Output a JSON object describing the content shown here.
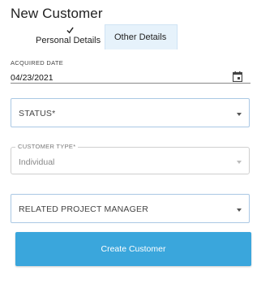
{
  "page": {
    "title": "New Customer"
  },
  "tabs": [
    {
      "label": "Personal Details",
      "completed": true
    },
    {
      "label": "Other Details",
      "active": true
    }
  ],
  "form": {
    "acquired_date": {
      "label": "ACQUIRED DATE",
      "value": "04/23/2021",
      "icon": "calendar-icon"
    },
    "status": {
      "label": "STATUS",
      "required_mark": "*"
    },
    "customer_type": {
      "label": "CUSTOMER TYPE",
      "required_mark": "*",
      "value": "Individual"
    },
    "project_manager": {
      "label": "RELATED PROJECT MANAGER"
    }
  },
  "actions": {
    "submit_label": "Create Customer"
  },
  "colors": {
    "accent": "#3aa6dc",
    "active_tab_bg": "#e6f2fb",
    "field_border": "#aac8e4"
  }
}
